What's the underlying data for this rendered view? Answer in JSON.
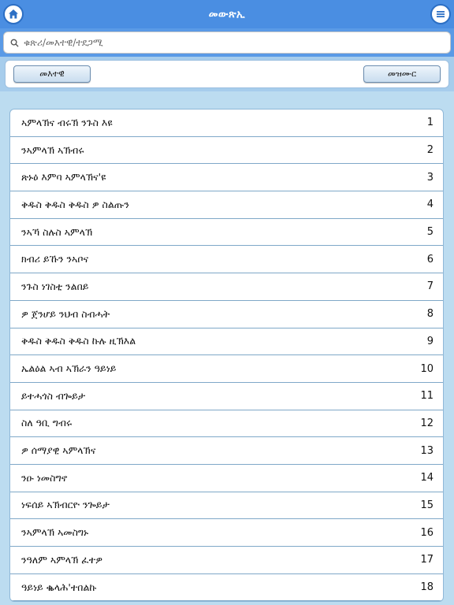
{
  "navbar": {
    "title": "መውጽኢ",
    "home_icon": "home-icon",
    "menu_icon": "menu-icon",
    "bg_color": "#4a8ee2"
  },
  "search": {
    "placeholder": "ቁጽሪ/መእተዊ/ተደጋሚ",
    "value": ""
  },
  "segments": {
    "left_label": "መእተዊ",
    "right_label": "መዝሙር"
  },
  "songs": [
    {
      "title": "ኣምላኽና ብሩኽ ንጉስ እዩ",
      "number": "1"
    },
    {
      "title": "ንኣምላኽ ኣኽብሩ",
      "number": "2"
    },
    {
      "title": "ጽኑዕ እምባ ኣምላኽና'ዩ",
      "number": "3"
    },
    {
      "title": "ቅዱስ ቅዱስ ቅዱስ ዎ ስልጡን",
      "number": "4"
    },
    {
      "title": "ንኣኻ ስሉስ ኣምላኽ",
      "number": "5"
    },
    {
      "title": "ክብሪ ይኹን ንኣቦና",
      "number": "6"
    },
    {
      "title": "ንጉስ ነገስቲ ንልበይ",
      "number": "7"
    },
    {
      "title": "ዎ ጀንሆይ ንህብ ስብሓት",
      "number": "8"
    },
    {
      "title": "ቅዱስ ቅዱስ ቅዱስ ኩሉ ዚኽእል",
      "number": "9"
    },
    {
      "title": "ኤልዕል ኣብ ኣኽራን ዓይነይ",
      "number": "10"
    },
    {
      "title": "ይተሓጎስ ብጐይታ",
      "number": "11"
    },
    {
      "title": "ስለ ዓቢ ግብሩ",
      "number": "12"
    },
    {
      "title": "ዎ ሰማያዊ ኣምላኽና",
      "number": "13"
    },
    {
      "title": "ንዑ ነመስግኖ",
      "number": "14"
    },
    {
      "title": "ነፍሰይ ኣኽብርዮ ንጐይታ",
      "number": "15"
    },
    {
      "title": "ንኣምላኽ ኣመስግኑ",
      "number": "16"
    },
    {
      "title": "ንዓለም ኣምላኽ ፈተዎ",
      "number": "17"
    },
    {
      "title": "ዓይነይ ቈላሕ'ተበልኩ",
      "number": "18"
    }
  ]
}
